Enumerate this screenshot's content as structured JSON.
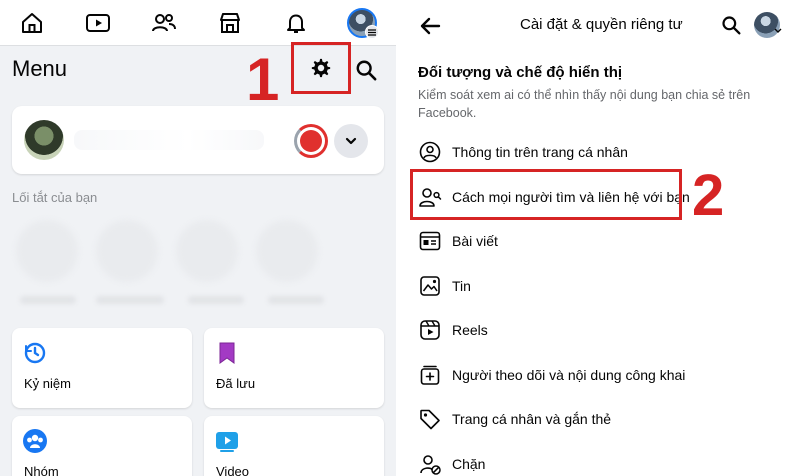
{
  "left": {
    "nav_icons": [
      "home-icon",
      "video-icon",
      "friends-icon",
      "marketplace-icon",
      "bell-icon",
      "profile-menu-icon"
    ],
    "menu_title": "Menu",
    "annotation_step": "1",
    "shortcuts_label": "Lối tắt của bạn",
    "tiles": [
      {
        "label": "Kỷ niệm",
        "icon": "memories-icon"
      },
      {
        "label": "Đã lưu",
        "icon": "saved-icon"
      },
      {
        "label": "Nhóm",
        "icon": "groups-icon"
      },
      {
        "label": "Video",
        "icon": "video-icon"
      }
    ]
  },
  "right": {
    "title": "Cài đặt & quyền riêng tư",
    "section_title": "Đối tượng và chế độ hiển thị",
    "section_desc": "Kiểm soát xem ai có thể nhìn thấy nội dung bạn chia sẻ trên Facebook.",
    "annotation_step": "2",
    "items": [
      {
        "label": "Thông tin trên trang cá nhân",
        "icon": "profile-info-icon"
      },
      {
        "label": "Cách mọi người tìm và liên hệ với bạn",
        "icon": "find-contact-icon"
      },
      {
        "label": "Bài viết",
        "icon": "posts-icon"
      },
      {
        "label": "Tin",
        "icon": "stories-icon"
      },
      {
        "label": "Reels",
        "icon": "reels-icon"
      },
      {
        "label": "Người theo dõi và nội dung công khai",
        "icon": "followers-icon"
      },
      {
        "label": "Trang cá nhân và gắn thẻ",
        "icon": "tag-icon"
      },
      {
        "label": "Chặn",
        "icon": "block-icon"
      }
    ]
  },
  "colors": {
    "annotation": "#d62424",
    "facebook_blue": "#1877f2",
    "panel_bg": "#f0f2f5"
  }
}
